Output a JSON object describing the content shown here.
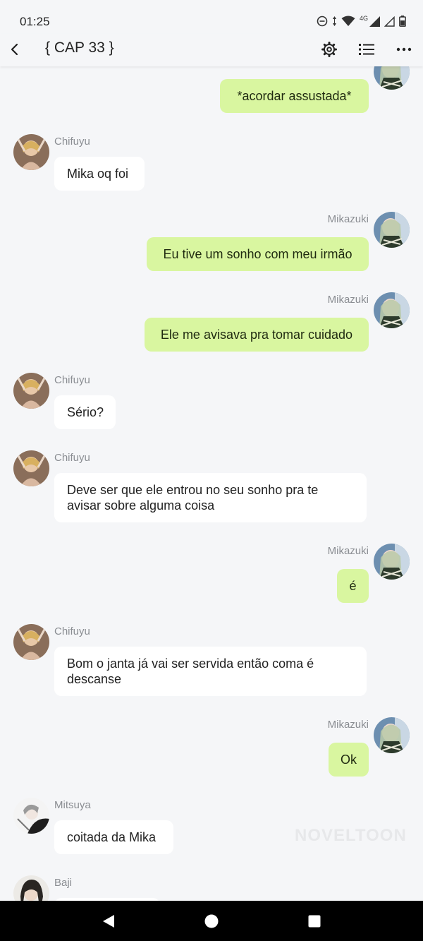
{
  "status_bar": {
    "time": "01:25",
    "network": "4G",
    "icons": [
      "do-not-disturb-icon",
      "data-arrows-icon",
      "wifi-icon",
      "signal-icon",
      "signal-empty-icon",
      "battery-icon"
    ]
  },
  "header": {
    "title": "{ CAP 33 }",
    "icons": [
      "back-arrow-icon",
      "settings-gear-icon",
      "list-icon",
      "more-dots-icon"
    ]
  },
  "messages": [
    {
      "sender": "Mikazuki",
      "side": "right",
      "text": "*acordar assustada*",
      "show_name": false
    },
    {
      "sender": "Chifuyu",
      "side": "left",
      "text": "Mika oq foi"
    },
    {
      "sender": "Mikazuki",
      "side": "right",
      "text": "Eu tive um sonho com meu irmão"
    },
    {
      "sender": "Mikazuki",
      "side": "right",
      "text": "Ele me avisava pra tomar cuidado"
    },
    {
      "sender": "Chifuyu",
      "side": "left",
      "text": "Sério?"
    },
    {
      "sender": "Chifuyu",
      "side": "left",
      "text": "Deve ser que ele entrou no seu sonho pra te avisar sobre alguma coisa"
    },
    {
      "sender": "Mikazuki",
      "side": "right",
      "text": "é"
    },
    {
      "sender": "Chifuyu",
      "side": "left",
      "text": "Bom o janta já vai ser servida então coma é descanse"
    },
    {
      "sender": "Mikazuki",
      "side": "right",
      "text": "Ok"
    },
    {
      "sender": "Mitsuya",
      "side": "left",
      "text": "coitada da Mika"
    },
    {
      "sender": "Baji",
      "side": "left",
      "text": ""
    }
  ],
  "watermark": "NOVELTOON",
  "colors": {
    "background": "#f5f6f8",
    "my_bubble": "#d9f6a0",
    "their_bubble": "#ffffff",
    "name_text": "#8a8d92",
    "nav_bar": "#000000"
  },
  "nav_bar": {
    "icons": [
      "back-triangle-icon",
      "home-circle-icon",
      "recents-square-icon"
    ]
  }
}
